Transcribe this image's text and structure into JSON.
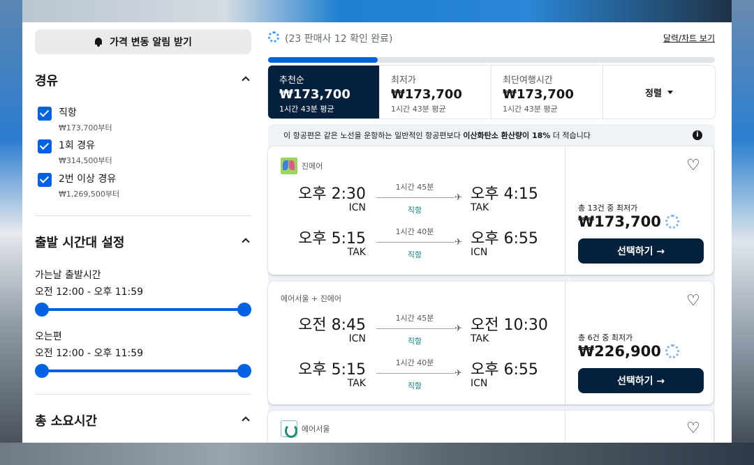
{
  "alert_button": {
    "label": "가격 변동 알림 받기"
  },
  "stops": {
    "title": "경유",
    "options": [
      {
        "label": "직항",
        "price": "₩173,700부터"
      },
      {
        "label": "1회 경유",
        "price": "₩314,500부터"
      },
      {
        "label": "2번 이상 경유",
        "price": "₩1,269,500부터"
      }
    ]
  },
  "departure_times": {
    "title": "출발 시간대 설정",
    "outbound_label": "가는날 출발시간",
    "outbound_range": "오전 12:00 - 오후 11:59",
    "return_label": "오는편",
    "return_range": "오전 12:00 - 오후 11:59"
  },
  "duration": {
    "title": "총 소요시간"
  },
  "progress": {
    "text": "(23 판매사 12 확인 완료)",
    "fraction": 0.245,
    "chart_link": "달력/차트 보기"
  },
  "sort_tabs": [
    {
      "name": "추천순",
      "price": "₩173,700",
      "sub": "1시간 43분 평균"
    },
    {
      "name": "최저가",
      "price": "₩173,700",
      "sub": "1시간 43분 평균"
    },
    {
      "name": "최단여행시간",
      "price": "₩173,700",
      "sub": "1시간 43분 평균"
    }
  ],
  "sort_button": {
    "label": "정렬"
  },
  "eco_banner": {
    "prefix": "이 항공편은 같은 노선을 운항하는 일반적인 항공편보다 ",
    "bold": "이산화탄소 환산량이 18%",
    "suffix": " 더 적습니다"
  },
  "flights": [
    {
      "airline": "진에어",
      "outbound": {
        "dep_time": "오후 2:30",
        "dep_code": "ICN",
        "duration": "1시간 45분",
        "stops": "직항",
        "arr_time": "오후 4:15",
        "arr_code": "TAK"
      },
      "inbound": {
        "dep_time": "오후 5:15",
        "dep_code": "TAK",
        "duration": "1시간 40분",
        "stops": "직항",
        "arr_time": "오후 6:55",
        "arr_code": "ICN"
      },
      "deal_label": "총 13건 중 최저가",
      "price": "₩173,700",
      "select_label": "선택하기 →"
    },
    {
      "airline": "에어서울 + 진에어",
      "outbound": {
        "dep_time": "오전 8:45",
        "dep_code": "ICN",
        "duration": "1시간 45분",
        "stops": "직항",
        "arr_time": "오전 10:30",
        "arr_code": "TAK"
      },
      "inbound": {
        "dep_time": "오후 5:15",
        "dep_code": "TAK",
        "duration": "1시간 40분",
        "stops": "직항",
        "arr_time": "오후 6:55",
        "arr_code": "ICN"
      },
      "deal_label": "총 6건 중 최저가",
      "price": "₩226,900",
      "select_label": "선택하기 →"
    },
    {
      "airline": "에어서울"
    }
  ],
  "icons": {
    "bell": "bell-icon",
    "chevron": "chevron-up-icon",
    "check": "checkbox-checked-icon",
    "heart": "heart-outline-icon",
    "plane": "plane-icon",
    "info": "info-icon",
    "spinner": "loading-spinner-icon"
  },
  "colors": {
    "accent": "#0062e3",
    "navy": "#05203c",
    "teal": "#0c838a"
  }
}
